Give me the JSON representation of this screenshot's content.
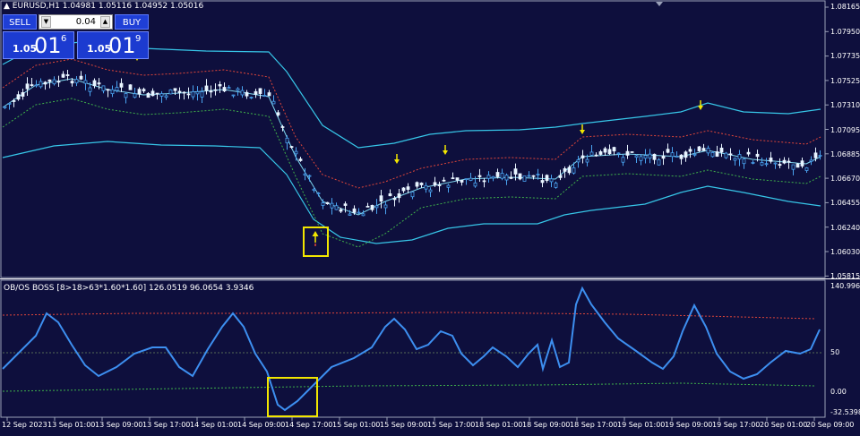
{
  "colors": {
    "background": "#0e0f3d",
    "grid_border": "#9aa0b8",
    "candle_up": "#4aa3f0",
    "candle_down": "#e8f4ff",
    "band": "#37c6e8",
    "midline": "#7fd8f0",
    "upper_dotted": "#e0463a",
    "lower_dotted": "#3fb04a",
    "arrow": "#f2e600",
    "highlight_box": "#f2e600",
    "oscillator": "#3d8ff0"
  },
  "window": {
    "title": "EURUSD,H1  1.04981 1.05116 1.04952 1.05016"
  },
  "one_click": {
    "sell_label": "SELL",
    "buy_label": "BUY",
    "lot_value": "0.04",
    "down_icon": "triangle-down-icon",
    "up_icon": "triangle-up-icon",
    "sell_price": {
      "small": "1.05",
      "big": "01",
      "sup": "6"
    },
    "buy_price": {
      "small": "1.05",
      "big": "01",
      "sup": "9"
    }
  },
  "price_axis": [
    "1.08165",
    "1.07950",
    "1.07735",
    "1.07525",
    "1.07310",
    "1.07095",
    "1.06885",
    "1.06670",
    "1.06455",
    "1.06240",
    "1.06030",
    "1.05815"
  ],
  "oscillator_axis": [
    "140.9961",
    "50",
    "0.00",
    "-32.5398"
  ],
  "oscillator_label": "OB/OS BOSS [8>18>63*1.60*1.60] 126.0519 96.0654 3.9346",
  "time_axis": [
    "12 Sep 2023",
    "13 Sep 01:00",
    "13 Sep 09:00",
    "13 Sep 17:00",
    "14 Sep 01:00",
    "14 Sep 09:00",
    "14 Sep 17:00",
    "15 Sep 01:00",
    "15 Sep 09:00",
    "15 Sep 17:00",
    "18 Sep 01:00",
    "18 Sep 09:00",
    "18 Sep 17:00",
    "19 Sep 01:00",
    "19 Sep 09:00",
    "19 Sep 17:00",
    "20 Sep 01:00",
    "20 Sep 09:00"
  ]
}
